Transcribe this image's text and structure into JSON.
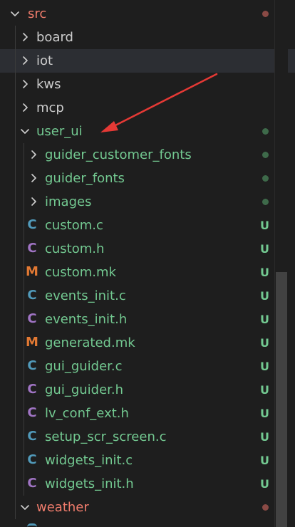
{
  "colors": {
    "background": "#1e1e1e",
    "folder_text": "#cccccc",
    "src_red": "#f07c6c",
    "untracked_green": "#73c991",
    "dot_red": "#8a4a45",
    "dot_green": "#3e6a4a",
    "arrow_red": "#e53935"
  },
  "tree": [
    {
      "label": "src",
      "type": "folder",
      "expanded": true,
      "depth": 0,
      "status": "modified",
      "color": "src_red",
      "decoration": "dot"
    },
    {
      "label": "board",
      "type": "folder",
      "expanded": false,
      "depth": 1,
      "color": "folder_text"
    },
    {
      "label": "iot",
      "type": "folder",
      "expanded": false,
      "depth": 1,
      "color": "folder_text",
      "selected": true
    },
    {
      "label": "kws",
      "type": "folder",
      "expanded": false,
      "depth": 1,
      "color": "folder_text"
    },
    {
      "label": "mcp",
      "type": "folder",
      "expanded": false,
      "depth": 1,
      "color": "folder_text"
    },
    {
      "label": "user_ui",
      "type": "folder",
      "expanded": true,
      "depth": 1,
      "color": "untracked_green",
      "decoration": "dot"
    },
    {
      "label": "guider_customer_fonts",
      "type": "folder",
      "expanded": false,
      "depth": 2,
      "color": "untracked_green",
      "decoration": "dot"
    },
    {
      "label": "guider_fonts",
      "type": "folder",
      "expanded": false,
      "depth": 2,
      "color": "untracked_green",
      "decoration": "dot"
    },
    {
      "label": "images",
      "type": "folder",
      "expanded": false,
      "depth": 2,
      "color": "untracked_green",
      "decoration": "dot"
    },
    {
      "label": "custom.c",
      "type": "file",
      "icon": "C",
      "icon_kind": "c",
      "depth": 2,
      "color": "untracked_green",
      "badge": "U"
    },
    {
      "label": "custom.h",
      "type": "file",
      "icon": "C",
      "icon_kind": "h",
      "depth": 2,
      "color": "untracked_green",
      "badge": "U"
    },
    {
      "label": "custom.mk",
      "type": "file",
      "icon": "M",
      "icon_kind": "m",
      "depth": 2,
      "color": "untracked_green",
      "badge": "U"
    },
    {
      "label": "events_init.c",
      "type": "file",
      "icon": "C",
      "icon_kind": "c",
      "depth": 2,
      "color": "untracked_green",
      "badge": "U"
    },
    {
      "label": "events_init.h",
      "type": "file",
      "icon": "C",
      "icon_kind": "h",
      "depth": 2,
      "color": "untracked_green",
      "badge": "U"
    },
    {
      "label": "generated.mk",
      "type": "file",
      "icon": "M",
      "icon_kind": "m",
      "depth": 2,
      "color": "untracked_green",
      "badge": "U"
    },
    {
      "label": "gui_guider.c",
      "type": "file",
      "icon": "C",
      "icon_kind": "c",
      "depth": 2,
      "color": "untracked_green",
      "badge": "U"
    },
    {
      "label": "gui_guider.h",
      "type": "file",
      "icon": "C",
      "icon_kind": "h",
      "depth": 2,
      "color": "untracked_green",
      "badge": "U"
    },
    {
      "label": "lv_conf_ext.h",
      "type": "file",
      "icon": "C",
      "icon_kind": "h",
      "depth": 2,
      "color": "untracked_green",
      "badge": "U"
    },
    {
      "label": "setup_scr_screen.c",
      "type": "file",
      "icon": "C",
      "icon_kind": "c",
      "depth": 2,
      "color": "untracked_green",
      "badge": "U"
    },
    {
      "label": "widgets_init.c",
      "type": "file",
      "icon": "C",
      "icon_kind": "c",
      "depth": 2,
      "color": "untracked_green",
      "badge": "U"
    },
    {
      "label": "widgets_init.h",
      "type": "file",
      "icon": "C",
      "icon_kind": "h",
      "depth": 2,
      "color": "untracked_green",
      "badge": "U"
    },
    {
      "label": "weather",
      "type": "folder",
      "expanded": true,
      "depth": 1,
      "status": "modified",
      "color": "src_red",
      "decoration": "dot"
    }
  ]
}
